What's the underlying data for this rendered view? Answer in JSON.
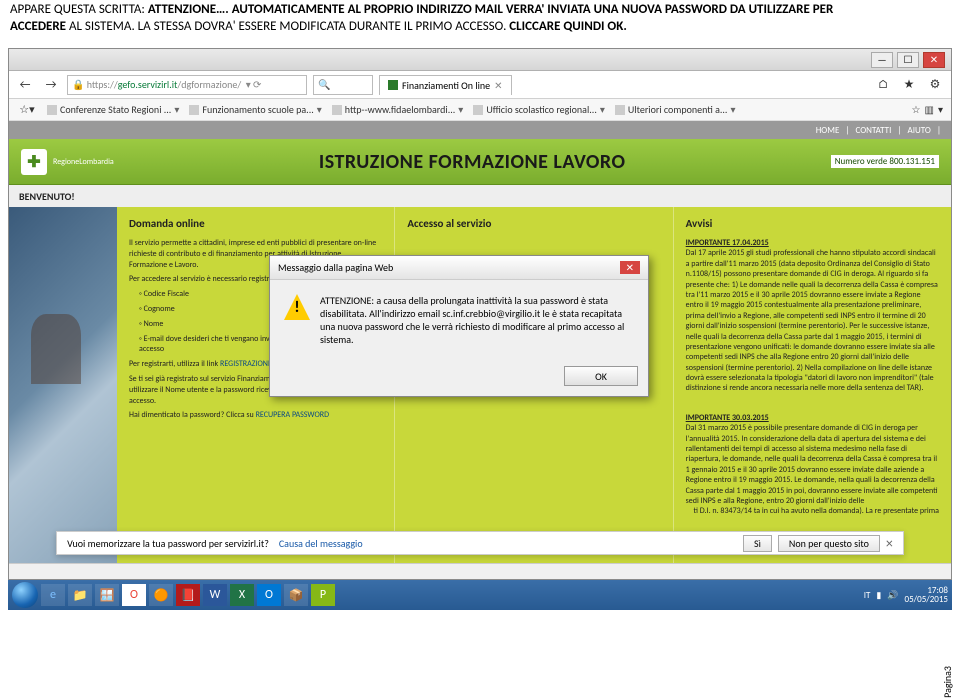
{
  "doc": {
    "line1a": "APPARE QUESTA SCRITTA: ",
    "line1b": "ATTENZIONE…. AUTOMATICAMENTE AL PROPRIO INDIRIZZO MAIL VERRA' INVIATA  UNA NUOVA PASSWORD DA UTILIZZARE PER",
    "line2a": "ACCEDERE",
    "line2b": " AL SISTEMA. LA STESSA DOVRA' ESSERE MODIFICATA DURANTE IL PRIMO ACCESSO. ",
    "line2c": "CLICCARE QUINDI OK."
  },
  "browser": {
    "titlebtns": {
      "min": "—",
      "max": "☐",
      "close": "✕"
    },
    "back": "←",
    "fwd": "→",
    "url_prefix": "https://",
    "url_host": "gefo.servizirl.it",
    "url_path": "/dgformazione/",
    "search_icons": "🔍",
    "lock": "🔒",
    "refresh": "⟳",
    "tab_title": "Finanziamenti On line",
    "tab_close": "✕",
    "newtab": "+",
    "home_ico": "⌂",
    "star": "★",
    "gear": "⚙"
  },
  "bookmarks": {
    "items": [
      "Conferenze Stato Regioni ...",
      "Funzionamento scuole pa...",
      "http--www.fidaelombardi...",
      "Ufficio scolastico regional...",
      "Ulteriori componenti a..."
    ],
    "star": "☆",
    "list": "▾"
  },
  "topnav": {
    "home": "HOME",
    "contatti": "CONTATTI",
    "aiuto": "AIUTO",
    "sep": "|"
  },
  "brand": {
    "mark": "✚",
    "name": "RegioneLombardia",
    "title": "ISTRUZIONE FORMAZIONE LAVORO",
    "phone": "Numero verde 800.131.151"
  },
  "welcome": "BENVENUTO!",
  "col1": {
    "h": "Domanda online",
    "p1": "Il servizio permette a cittadini, imprese ed enti pubblici di presentare on-line richieste di contributo e di finanziamento per attività di Istruzione, Formazione e Lavoro.",
    "p2": "Per accedere al servizio è necessario registrarsi, inserendo i dati personali:",
    "li": [
      "Codice Fiscale",
      "Cognome",
      "Nome",
      "E-mail dove desideri che ti vengano inviati Nome utente e password di accesso"
    ],
    "p3a": "Per registrarti, utilizza il link ",
    "p3link": "REGISTRAZIONE UTENTE",
    "p4": "Se ti sei già registrato sul servizio Finanziamenti del Sistema Dote devi utilizzare il Nome utente e la password ricevuti al momento del primo accesso.",
    "p5a": "Hai dimenticato la password? Clicca su ",
    "p5link": "RECUPERA PASSWORD"
  },
  "col2": {
    "h": "Accesso al servizio"
  },
  "col3": {
    "h": "Avvisi",
    "imp1": "IMPORTANTE 17.04.2015",
    "t1": "Dal 17 aprile 2015 gli studi professionali che hanno stipulato accordi sindacali a partire dall'11 marzo 2015 (data deposito Ordinanza del Consiglio di Stato n.1108/15) possono presentare domande di CIG in deroga. Al riguardo si fa presente che: 1) Le domande nelle quali la decorrenza della Cassa è compresa tra l'11 marzo 2015 e il 30 aprile 2015 dovranno essere inviate a Regione entro il 19 maggio 2015 contestualmente alla presentazione preliminare, prima dell'invio a Regione, alle competenti sedi INPS entro il termine di 20 giorni dall'inizio sospensioni (termine perentorio). Per le successive istanze, nelle quali la decorrenza della Cassa parte dal 1 maggio 2015, i termini di presentazione vengono unificati: le domande dovranno essere inviate sia alle competenti sedi INPS che alla Regione entro 20 giorni dall'inizio delle sospensioni (termine perentorio). 2) Nella compilazione on line delle istanze dovrà essere selezionata la tipologia \"datori di lavoro non imprenditori\" (tale distinzione si rende ancora necessaria nelle more della sentenza del TAR).",
    "imp2": "IMPORTANTE 30.03.2015",
    "t2": "Dal 31 marzo 2015 è possibile presentare domande di CIG in deroga per l'annualità 2015. In considerazione della data di apertura del sistema e dei rallentamenti dei tempi di accesso al sistema medesimo nella fase di riapertura, le domande, nelle quali la decorrenza della Cassa è compresa tra il 1 gennaio 2015 e il 30 aprile 2015 dovranno essere inviate dalle aziende a Regione entro il 19 maggio 2015. Le domande, nella quali la decorrenza della Cassa parte dal 1 maggio 2015 in poi, dovranno essere inviate alle competenti sedi INPS e alla Regione, entro 20 giorni dall'inizio delle",
    "t2b": "ti D.I. n. 83473/14 ta in cui ha avuto nella domanda). La re presentate prima"
  },
  "alert": {
    "title": "Messaggio dalla pagina Web",
    "close": "✕",
    "body": "ATTENZIONE: a causa della prolungata inattività la sua password è stata disabilitata. All'indirizzo email sc.inf.crebbio@virgilio.it le è stata recapitata una nuova password che le verrà richiesto di modificare al primo accesso al sistema.",
    "ok": "OK"
  },
  "pwbar": {
    "q": "Vuoi memorizzare la tua password per servizirl.it?",
    "why": "Causa del messaggio",
    "yes": "Sì",
    "no": "Non per questo sito",
    "x": "×"
  },
  "taskbar": {
    "icons": [
      "e",
      "📁",
      "🪟",
      "O",
      "🟠",
      "📕",
      "W",
      "X",
      "O",
      "📦",
      "P"
    ],
    "lang": "IT",
    "flag": "▮",
    "vol": "🔊",
    "time": "17:08",
    "date": "05/05/2015"
  },
  "pagenum": "Pagina3"
}
